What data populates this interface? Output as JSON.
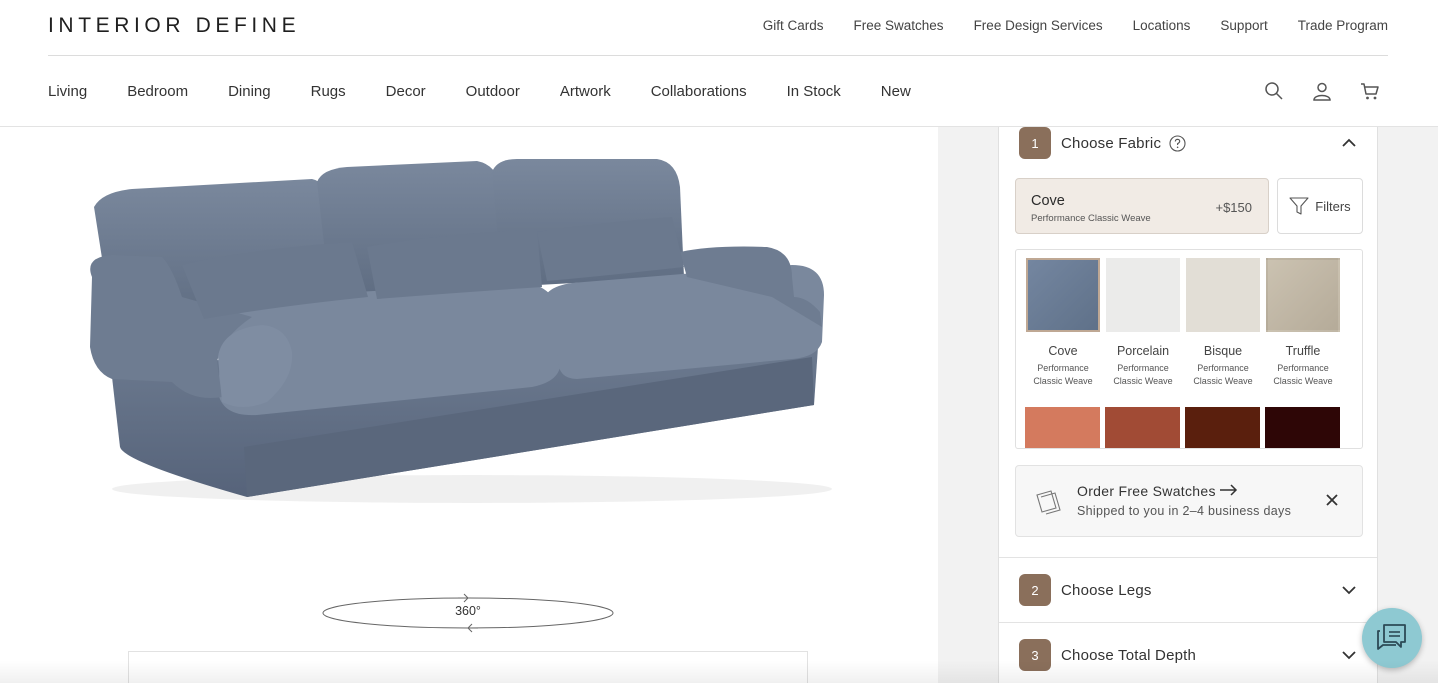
{
  "brand": {
    "logo": "INTERIOR DEFINE"
  },
  "utility_nav": [
    "Gift Cards",
    "Free Swatches",
    "Free Design Services",
    "Locations",
    "Support",
    "Trade Program"
  ],
  "main_nav": [
    "Living",
    "Bedroom",
    "Dining",
    "Rugs",
    "Decor",
    "Outdoor",
    "Artwork",
    "Collaborations",
    "In Stock",
    "New"
  ],
  "nav_icons": [
    "search-icon",
    "account-icon",
    "cart-icon"
  ],
  "viewer": {
    "rotate_label": "360°"
  },
  "steps": [
    {
      "num": "1",
      "title": "Choose Fabric",
      "expanded": true
    },
    {
      "num": "2",
      "title": "Choose Legs",
      "expanded": false
    },
    {
      "num": "3",
      "title": "Choose Total Depth",
      "expanded": false
    }
  ],
  "selected_fabric": {
    "name": "Cove",
    "subtitle": "Performance Classic Weave",
    "price": "+$150"
  },
  "filters_label": "Filters",
  "swatches": [
    {
      "name": "Cove",
      "desc_line1": "Performance",
      "desc_line2": "Classic Weave",
      "color": "#6b7d96",
      "selected": true
    },
    {
      "name": "Porcelain",
      "desc_line1": "Performance",
      "desc_line2": "Classic Weave",
      "color": "#ebebea",
      "selected": false
    },
    {
      "name": "Bisque",
      "desc_line1": "Performance",
      "desc_line2": "Classic Weave",
      "color": "#e2ded6",
      "selected": false
    },
    {
      "name": "Truffle",
      "desc_line1": "Performance",
      "desc_line2": "Classic Weave",
      "color": "#c2b8a6",
      "selected": false
    }
  ],
  "swatch_row2_colors": [
    "#d47a5e",
    "#a14b35",
    "#5a1f0d",
    "#2e0606"
  ],
  "order_swatches": {
    "title": "Order Free Swatches",
    "subtitle": "Shipped to you in 2–4 business days"
  },
  "colors": {
    "step_badge": "#8a6f5b",
    "selected_bg": "#f1ebe5",
    "chat": "#8ec9d2",
    "sofa": "#6d7c93"
  }
}
